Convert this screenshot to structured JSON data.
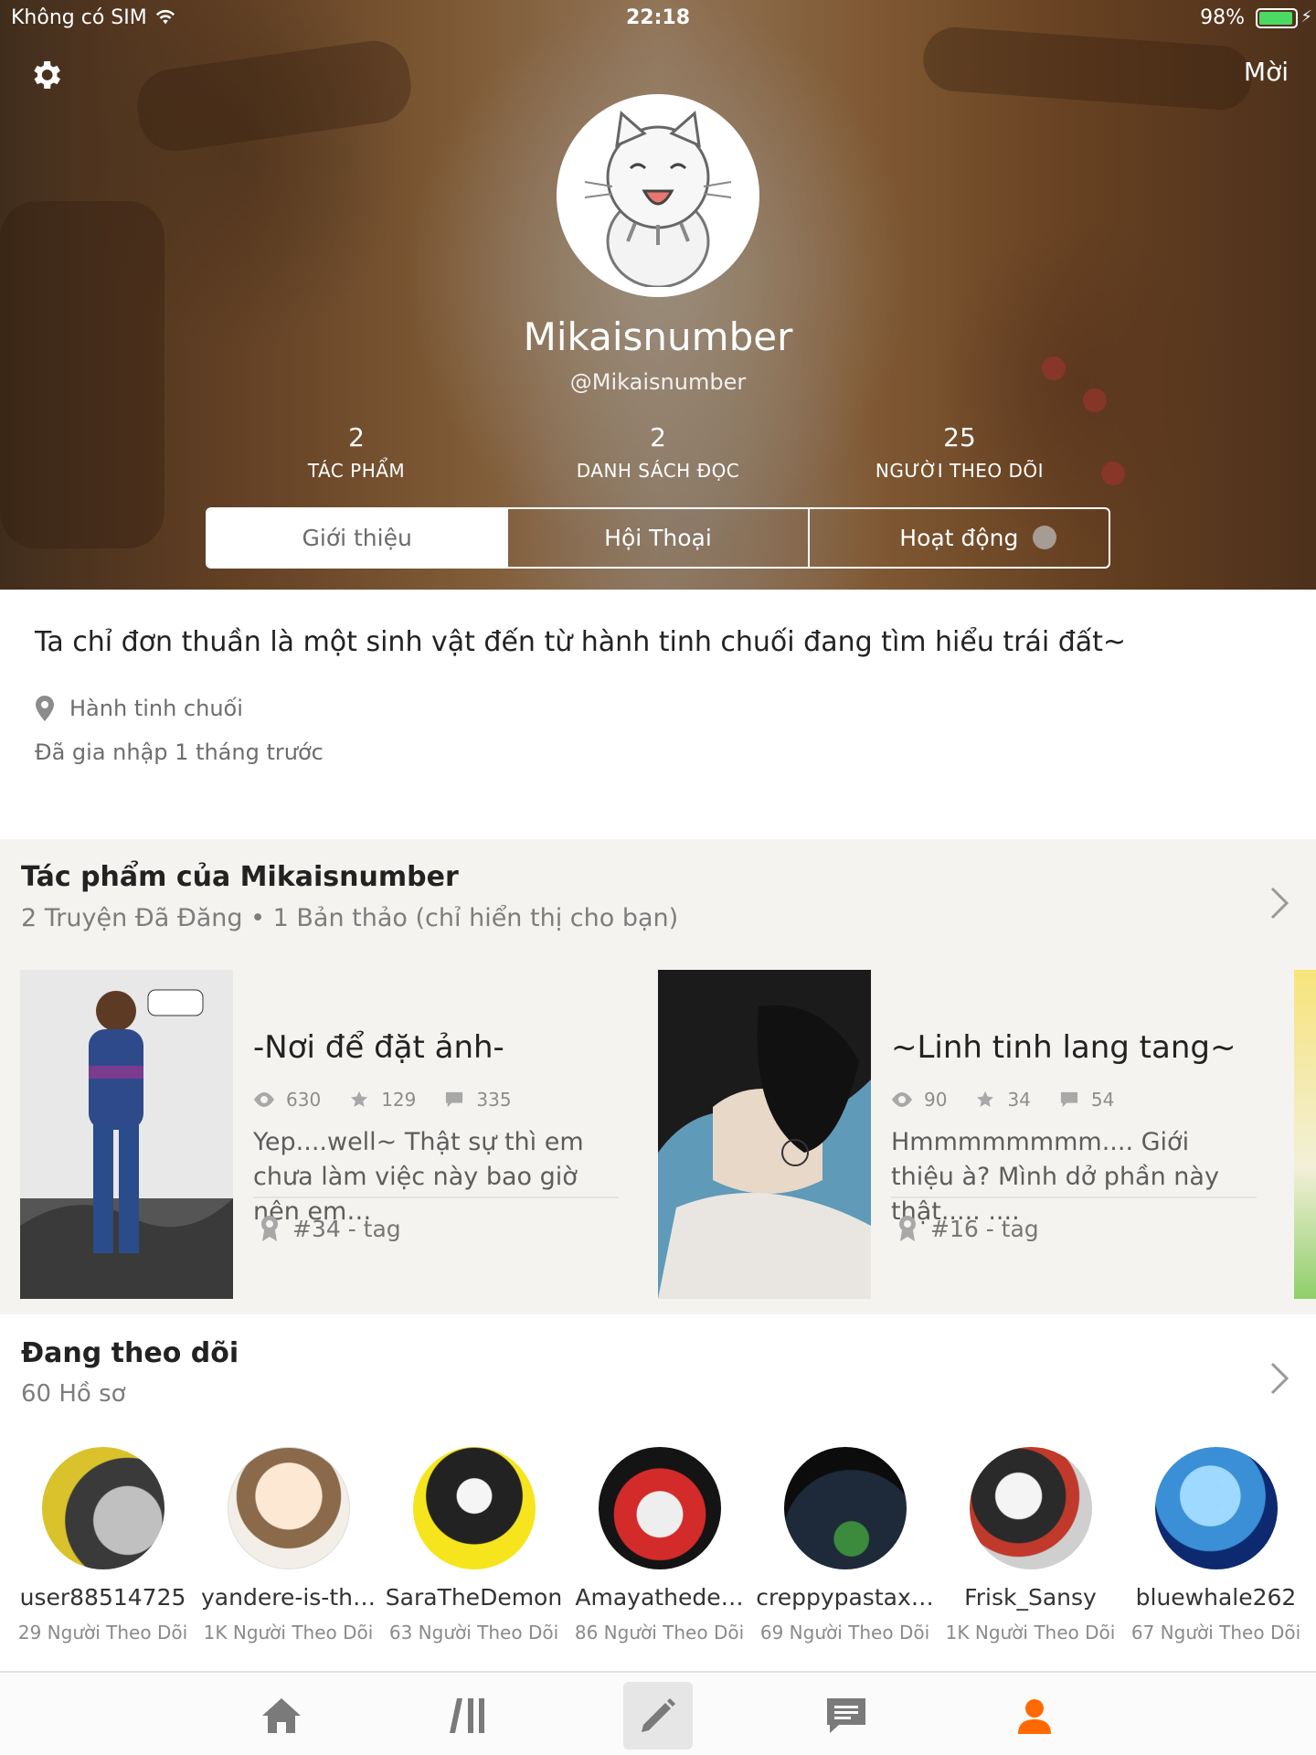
{
  "status_bar": {
    "carrier": "Không có SIM",
    "time": "22:18",
    "battery": "98%"
  },
  "header": {
    "invite_label": "Mời",
    "username": "Mikaisnumber",
    "handle": "@Mikaisnumber",
    "stats": [
      {
        "value": "2",
        "label": "TÁC PHẨM"
      },
      {
        "value": "2",
        "label": "DANH SÁCH ĐỌC"
      },
      {
        "value": "25",
        "label": "NGƯỜI THEO DÕI"
      }
    ],
    "tabs": [
      {
        "label": "Giới thiệu",
        "active": true
      },
      {
        "label": "Hội Thoại",
        "active": false
      },
      {
        "label": "Hoạt động",
        "active": false
      }
    ]
  },
  "about": {
    "bio": "Ta chỉ đơn thuần là một sinh vật đến từ hành tinh chuối đang tìm hiểu trái đất~",
    "location": "Hành tinh chuối",
    "joined": "Đã gia nhập 1 tháng trước"
  },
  "works": {
    "title": "Tác phẩm của Mikaisnumber",
    "subtitle": "2 Truyện Đã Đăng • 1 Bản thảo (chỉ hiển thị cho bạn)",
    "stories": [
      {
        "title": "-Nơi để đặt ảnh-",
        "reads": "630",
        "votes": "129",
        "comments": "335",
        "description": "Yep....well~ Thật sự thì em chưa làm việc này bao giờ nên em…",
        "tag": "#34 - tag"
      },
      {
        "title": "~Linh tinh lang tang~",
        "reads": "90",
        "votes": "34",
        "comments": "54",
        "description": "Hmmmmmmmm.... Giới thiệu à? Mình dở phần này thật..... ....",
        "tag": "#16 - tag"
      }
    ]
  },
  "following": {
    "title": "Đang theo dõi",
    "subtitle": "60 Hồ sơ",
    "people": [
      {
        "name": "user88514725",
        "followers": "29 Người Theo Dõi"
      },
      {
        "name": "yandere-is-th…",
        "followers": "1K Người Theo Dõi"
      },
      {
        "name": "SaraTheDemon",
        "followers": "63 Người Theo Dõi"
      },
      {
        "name": "Amayathede…",
        "followers": "86 Người Theo Dõi"
      },
      {
        "name": "creppypastax…",
        "followers": "69 Người Theo Dõi"
      },
      {
        "name": "Frisk_Sansy",
        "followers": "1K Người Theo Dõi"
      },
      {
        "name": "bluewhale262",
        "followers": "67 Người Theo Dõi"
      }
    ]
  },
  "nav": {
    "items": [
      "home-icon",
      "library-icon",
      "compose-icon",
      "messages-icon",
      "profile-icon"
    ],
    "active": "profile-icon"
  },
  "colors": {
    "accent": "#ff6a00",
    "tab_border": "#ffffff",
    "battery": "#4cd964"
  }
}
